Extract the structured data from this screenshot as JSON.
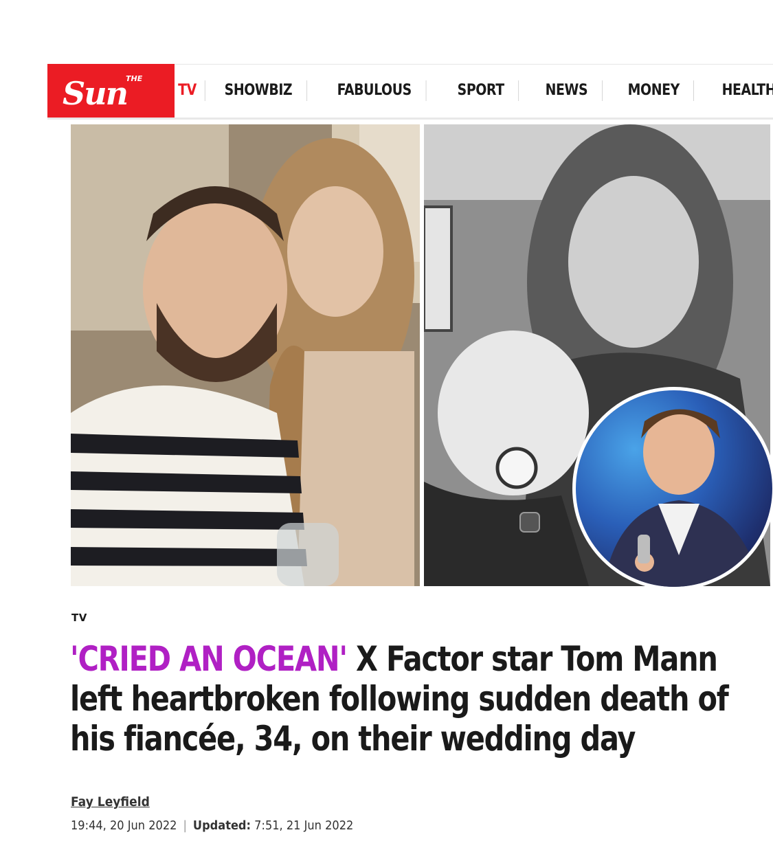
{
  "brand": {
    "logo_small": "THE",
    "logo_text": "Sun",
    "accent": "#eb1c24"
  },
  "nav": {
    "items": [
      {
        "label": "TV"
      },
      {
        "label": "SHOWBIZ"
      },
      {
        "label": "FABULOUS"
      },
      {
        "label": "SPORT"
      },
      {
        "label": "NEWS"
      },
      {
        "label": "MONEY"
      },
      {
        "label": "HEALTH"
      }
    ]
  },
  "article": {
    "section": "TV",
    "kicker": "'CRIED AN OCEAN'",
    "headline": " X Factor star Tom Mann left heartbroken following sudden death of his fiancée, 34, on their wedding day",
    "kicker_color": "#b020c4",
    "author": "Fay Leyfield",
    "published": "19:44, 20 Jun 2022",
    "updated_label": "Updated:",
    "updated": "7:51, 21 Jun 2022"
  }
}
